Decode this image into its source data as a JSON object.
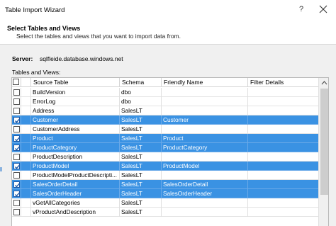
{
  "window": {
    "title": "Table Import Wizard",
    "help_icon": "?",
    "close_icon": "close-icon"
  },
  "header": {
    "title": "Select Tables and Views",
    "subtitle": "Select the tables and views that you want to import data from."
  },
  "server": {
    "label": "Server:",
    "name": "sqlfleide.database.windows.net"
  },
  "tables_label": "Tables and Views:",
  "grid": {
    "columns": [
      "Source Table",
      "Schema",
      "Friendly Name",
      "Filter Details"
    ],
    "rows": [
      {
        "checked": false,
        "selected": false,
        "source": "BuildVersion",
        "schema": "dbo",
        "friendly": "",
        "filter": ""
      },
      {
        "checked": false,
        "selected": false,
        "source": "ErrorLog",
        "schema": "dbo",
        "friendly": "",
        "filter": ""
      },
      {
        "checked": false,
        "selected": false,
        "source": "Address",
        "schema": "SalesLT",
        "friendly": "",
        "filter": ""
      },
      {
        "checked": true,
        "selected": true,
        "source": "Customer",
        "schema": "SalesLT",
        "friendly": "Customer",
        "filter": ""
      },
      {
        "checked": false,
        "selected": false,
        "source": "CustomerAddress",
        "schema": "SalesLT",
        "friendly": "",
        "filter": ""
      },
      {
        "checked": true,
        "selected": true,
        "source": "Product",
        "schema": "SalesLT",
        "friendly": "Product",
        "filter": ""
      },
      {
        "checked": true,
        "selected": true,
        "source": "ProductCategory",
        "schema": "SalesLT",
        "friendly": "ProductCategory",
        "filter": ""
      },
      {
        "checked": false,
        "selected": false,
        "source": "ProductDescription",
        "schema": "SalesLT",
        "friendly": "",
        "filter": ""
      },
      {
        "checked": true,
        "selected": true,
        "source": "ProductModel",
        "schema": "SalesLT",
        "friendly": "ProductModel",
        "filter": ""
      },
      {
        "checked": false,
        "selected": false,
        "source": "ProductModelProductDescripti...",
        "schema": "SalesLT",
        "friendly": "",
        "filter": ""
      },
      {
        "checked": true,
        "selected": true,
        "source": "SalesOrderDetail",
        "schema": "SalesLT",
        "friendly": "SalesOrderDetail",
        "filter": ""
      },
      {
        "checked": true,
        "selected": true,
        "source": "SalesOrderHeader",
        "schema": "SalesLT",
        "friendly": "SalesOrderHeader",
        "filter": ""
      },
      {
        "checked": false,
        "selected": false,
        "source": "vGetAllCategories",
        "schema": "SalesLT",
        "friendly": "",
        "filter": ""
      },
      {
        "checked": false,
        "selected": false,
        "source": "vProductAndDescription",
        "schema": "SalesLT",
        "friendly": "",
        "filter": ""
      }
    ]
  },
  "colors": {
    "selection": "#3a92e3",
    "checkmark": "#1e5aa8"
  }
}
